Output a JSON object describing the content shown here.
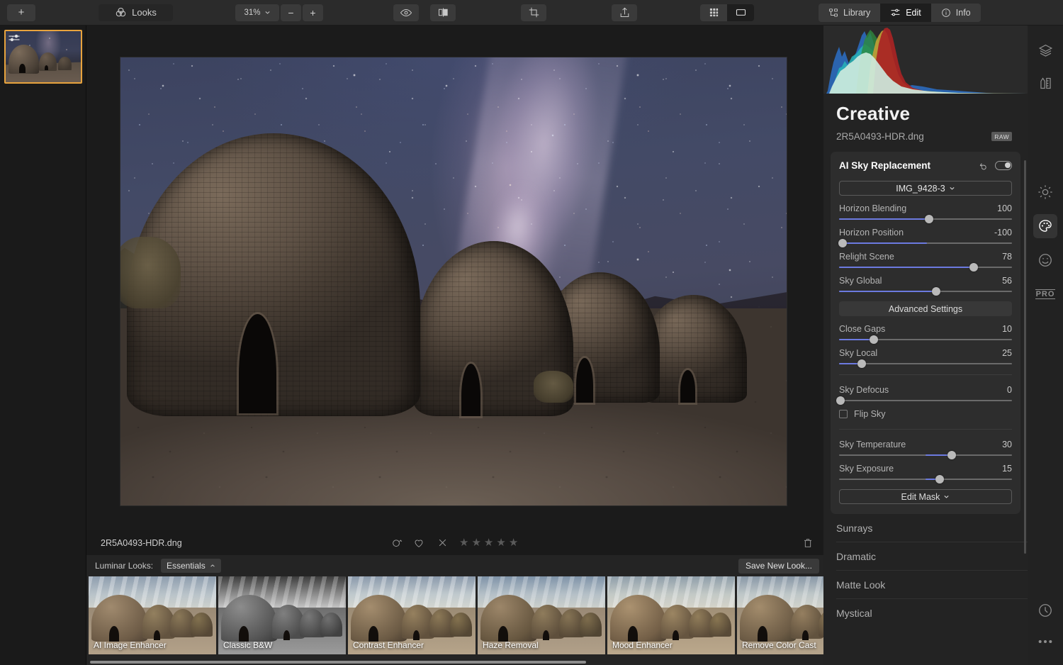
{
  "toolbar": {
    "add_label": "+",
    "looks_label": "Looks",
    "zoom_value": "31%",
    "zoom_out": "−",
    "zoom_in": "+",
    "icons": {
      "looks": "looks-venn-icon",
      "eye": "eye-preview-icon",
      "compare": "compare-split-icon",
      "crop": "crop-icon",
      "share": "share-export-icon",
      "grid": "grid-view-icon",
      "single": "single-view-icon"
    },
    "segments": [
      {
        "label": "Library",
        "icon": "library-icon",
        "active": false
      },
      {
        "label": "Edit",
        "icon": "sliders-icon",
        "active": true
      },
      {
        "label": "Info",
        "icon": "info-circle-icon",
        "active": false
      }
    ]
  },
  "filmstrip": {
    "thumb_name": "2R5A0493-HDR.dng",
    "selected": true,
    "edited_badge": "adjustments-badge-icon"
  },
  "infobar": {
    "filename": "2R5A0493-HDR.dng",
    "flag_icon": "flag-circle-icon",
    "heart_icon": "heart-icon",
    "reject_icon": "reject-x-icon",
    "stars": [
      "★",
      "★",
      "★",
      "★",
      "★"
    ],
    "trash_icon": "trash-icon"
  },
  "looks": {
    "label": "Luminar Looks:",
    "category": "Essentials",
    "category_chevron": "chevron-up-icon",
    "save_label": "Save New Look...",
    "items": [
      {
        "label": "AI Image Enhancer",
        "style": "color"
      },
      {
        "label": "Classic B&W",
        "style": "bw"
      },
      {
        "label": "Contrast Enhancer",
        "style": "color"
      },
      {
        "label": "Haze Removal",
        "style": "color"
      },
      {
        "label": "Mood Enhancer",
        "style": "color"
      },
      {
        "label": "Remove Color Cast",
        "style": "color"
      }
    ]
  },
  "right_panel": {
    "title": "Creative",
    "filename": "2R5A0493-HDR.dng",
    "raw_badge": "RAW",
    "tool": {
      "name": "AI Sky Replacement",
      "reset_icon": "reset-undo-icon",
      "toggle_icon": "toggle-on-icon",
      "sky_select": "IMG_9428-3",
      "sky_select_chevron": "chevron-down-icon",
      "advanced_settings": "Advanced Settings",
      "edit_mask": "Edit Mask",
      "edit_mask_chevron": "chevron-down-icon",
      "flip_sky_label": "Flip Sky",
      "flip_sky_checked": false,
      "sliders": [
        {
          "name": "Horizon Blending",
          "value": "100",
          "pct": 52,
          "fill_from": 0,
          "fill_to": 52
        },
        {
          "name": "Horizon Position",
          "value": "-100",
          "pct": 2,
          "fill_from": 2,
          "fill_to": 51
        },
        {
          "name": "Relight Scene",
          "value": "78",
          "pct": 78,
          "fill_from": 0,
          "fill_to": 78
        },
        {
          "name": "Sky Global",
          "value": "56",
          "pct": 56,
          "fill_from": 0,
          "fill_to": 56
        },
        {
          "name": "Close Gaps",
          "value": "10",
          "pct": 20,
          "fill_from": 0,
          "fill_to": 20
        },
        {
          "name": "Sky Local",
          "value": "25",
          "pct": 13,
          "fill_from": 0,
          "fill_to": 13
        },
        {
          "name": "Sky Defocus",
          "value": "0",
          "pct": 1,
          "fill_from": 0,
          "fill_to": 0
        },
        {
          "name": "Sky Temperature",
          "value": "30",
          "pct": 65,
          "fill_from": 50,
          "fill_to": 65
        },
        {
          "name": "Sky Exposure",
          "value": "15",
          "pct": 58,
          "fill_from": 50,
          "fill_to": 58
        }
      ]
    },
    "list_items": [
      "Sunrays",
      "Dramatic",
      "Matte Look",
      "Mystical"
    ]
  },
  "rail": {
    "items": [
      {
        "icon": "layers-icon",
        "active": false
      },
      {
        "icon": "tools-pencil-ruler-icon",
        "active": false
      },
      {
        "icon": "sun-essentials-icon",
        "active": false
      },
      {
        "icon": "palette-creative-icon",
        "active": true
      },
      {
        "icon": "portrait-smiley-icon",
        "active": false
      },
      {
        "icon": "pro-icon",
        "active": false,
        "label": "PRO"
      }
    ],
    "bottom": [
      {
        "icon": "history-clock-icon"
      },
      {
        "icon": "more-dots-icon"
      }
    ]
  },
  "colors": {
    "accent_blue": "#6c7ae0",
    "selection_orange": "#e8a33d",
    "panel_bg": "#232323",
    "card_bg": "#2d2d2d",
    "toolbar_bg": "#2b2b2b"
  }
}
